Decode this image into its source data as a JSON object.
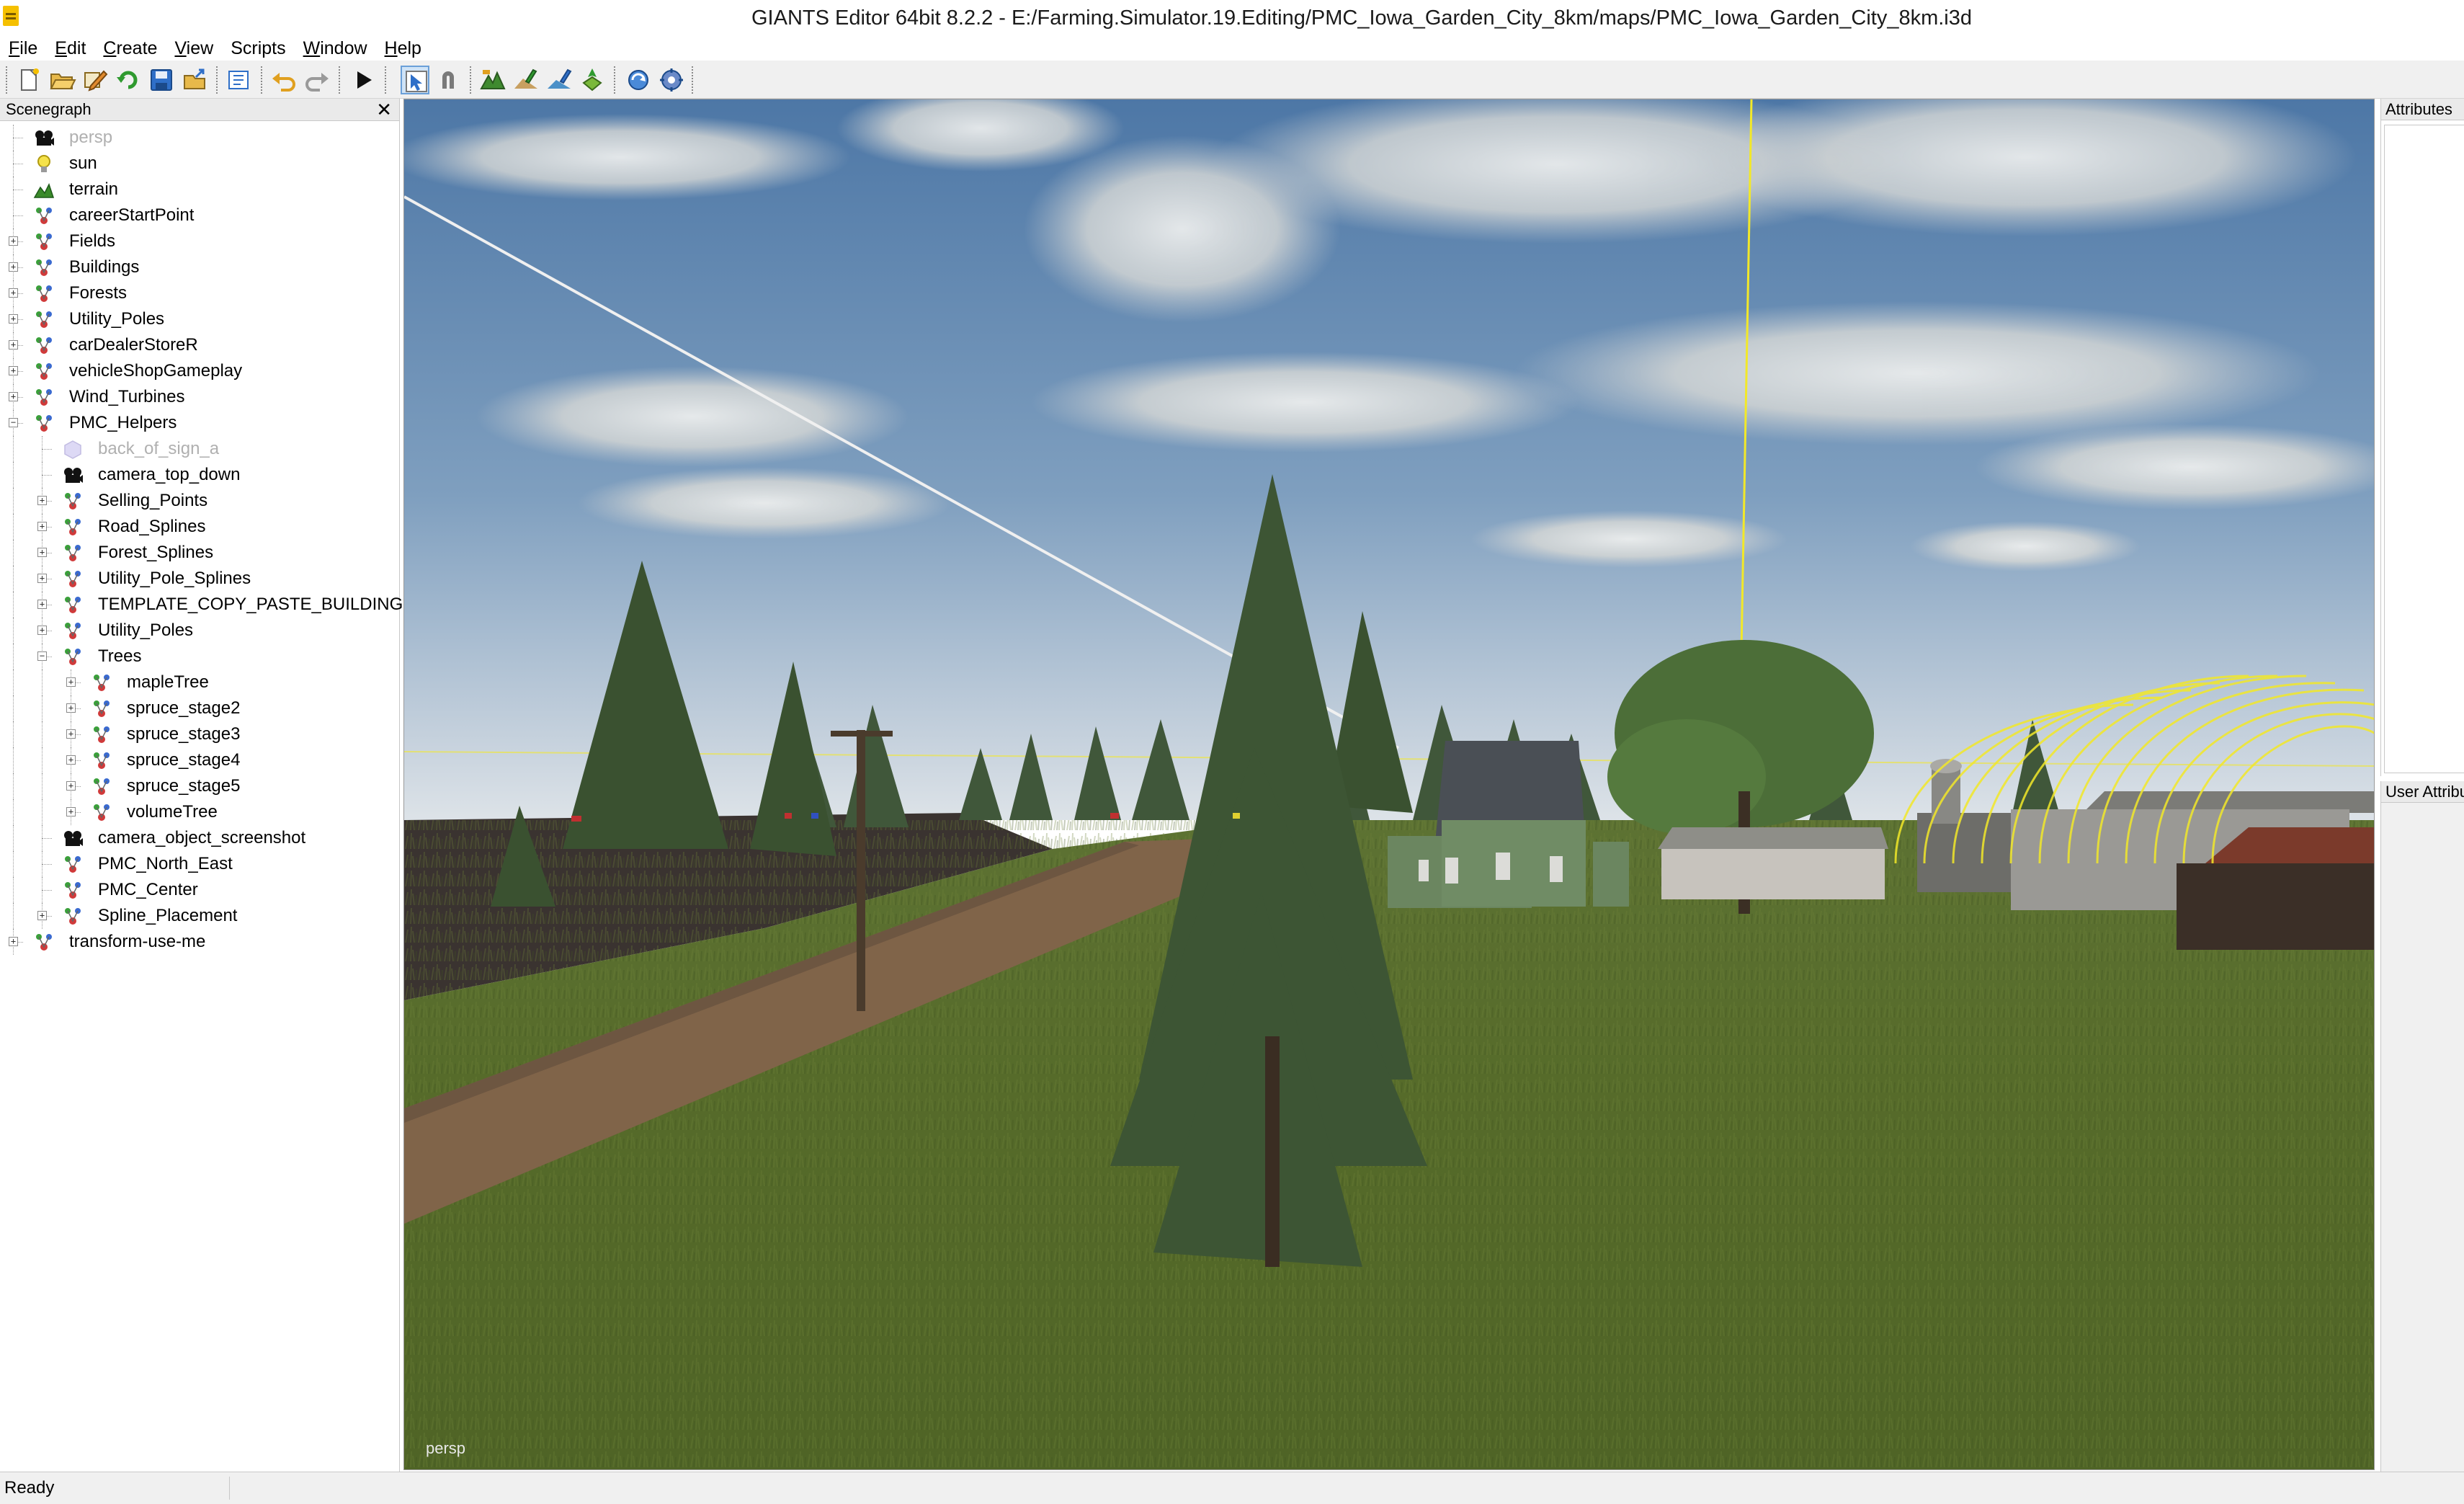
{
  "window": {
    "title": "GIANTS Editor 64bit 8.2.2 - E:/Farming.Simulator.19.Editing/PMC_Iowa_Garden_City_8km/maps/PMC_Iowa_Garden_City_8km.i3d"
  },
  "menu": [
    {
      "mnemonic": "F",
      "rest": "ile"
    },
    {
      "mnemonic": "E",
      "rest": "dit"
    },
    {
      "mnemonic": "C",
      "rest": "reate"
    },
    {
      "mnemonic": "V",
      "rest": "iew"
    },
    {
      "mnemonic": "",
      "rest": "Scripts"
    },
    {
      "mnemonic": "W",
      "rest": "indow"
    },
    {
      "mnemonic": "H",
      "rest": "elp"
    }
  ],
  "toolbar": {
    "buttons": [
      {
        "name": "new-icon"
      },
      {
        "name": "open-icon"
      },
      {
        "name": "edit-icon"
      },
      {
        "name": "reload-icon"
      },
      {
        "name": "save-icon"
      },
      {
        "name": "export-icon"
      },
      {
        "name": "import-icon"
      },
      {
        "name": "undo-icon"
      },
      {
        "name": "redo-icon"
      },
      {
        "name": "play-icon"
      },
      {
        "name": "select-tool-icon"
      },
      {
        "name": "magnet-icon"
      },
      {
        "name": "terrain-sculpt-icon"
      },
      {
        "name": "terrain-paint-icon"
      },
      {
        "name": "foliage-paint-icon"
      },
      {
        "name": "placement-icon"
      },
      {
        "name": "refresh-world-icon"
      },
      {
        "name": "settings-icon"
      }
    ]
  },
  "scenegraph": {
    "title": "Scenegraph",
    "close_label": "✕",
    "nodes": [
      {
        "label": "persp",
        "icon": "camera-icon",
        "depth": 0,
        "expander": "",
        "dim": true
      },
      {
        "label": "sun",
        "icon": "light-bulb-icon",
        "depth": 0,
        "expander": "",
        "dim": false
      },
      {
        "label": "terrain",
        "icon": "terrain-icon",
        "depth": 0,
        "expander": "",
        "dim": false
      },
      {
        "label": "careerStartPoint",
        "icon": "transform-group-icon",
        "depth": 0,
        "expander": "",
        "dim": false
      },
      {
        "label": "Fields",
        "icon": "transform-group-icon",
        "depth": 0,
        "expander": "+",
        "dim": false
      },
      {
        "label": "Buildings",
        "icon": "transform-group-icon",
        "depth": 0,
        "expander": "+",
        "dim": false
      },
      {
        "label": "Forests",
        "icon": "transform-group-icon",
        "depth": 0,
        "expander": "+",
        "dim": false
      },
      {
        "label": "Utility_Poles",
        "icon": "transform-group-icon",
        "depth": 0,
        "expander": "+",
        "dim": false
      },
      {
        "label": "carDealerStoreR",
        "icon": "transform-group-icon",
        "depth": 0,
        "expander": "+",
        "dim": false
      },
      {
        "label": "vehicleShopGameplay",
        "icon": "transform-group-icon",
        "depth": 0,
        "expander": "+",
        "dim": false
      },
      {
        "label": "Wind_Turbines",
        "icon": "transform-group-icon",
        "depth": 0,
        "expander": "+",
        "dim": false
      },
      {
        "label": "PMC_Helpers",
        "icon": "transform-group-icon",
        "depth": 0,
        "expander": "−",
        "dim": false
      },
      {
        "label": "back_of_sign_a",
        "icon": "shape-icon",
        "depth": 1,
        "expander": "",
        "dim": true
      },
      {
        "label": "camera_top_down",
        "icon": "camera-icon",
        "depth": 1,
        "expander": "",
        "dim": false
      },
      {
        "label": "Selling_Points",
        "icon": "transform-group-icon",
        "depth": 1,
        "expander": "+",
        "dim": false
      },
      {
        "label": "Road_Splines",
        "icon": "transform-group-icon",
        "depth": 1,
        "expander": "+",
        "dim": false
      },
      {
        "label": "Forest_Splines",
        "icon": "transform-group-icon",
        "depth": 1,
        "expander": "+",
        "dim": false
      },
      {
        "label": "Utility_Pole_Splines",
        "icon": "transform-group-icon",
        "depth": 1,
        "expander": "+",
        "dim": false
      },
      {
        "label": "TEMPLATE_COPY_PASTE_BUILDING",
        "icon": "transform-group-icon",
        "depth": 1,
        "expander": "+",
        "dim": false
      },
      {
        "label": "Utility_Poles",
        "icon": "transform-group-icon",
        "depth": 1,
        "expander": "+",
        "dim": false
      },
      {
        "label": "Trees",
        "icon": "transform-group-icon",
        "depth": 1,
        "expander": "−",
        "dim": false
      },
      {
        "label": "mapleTree",
        "icon": "transform-group-icon",
        "depth": 2,
        "expander": "+",
        "dim": false
      },
      {
        "label": "spruce_stage2",
        "icon": "transform-group-icon",
        "depth": 2,
        "expander": "+",
        "dim": false
      },
      {
        "label": "spruce_stage3",
        "icon": "transform-group-icon",
        "depth": 2,
        "expander": "+",
        "dim": false
      },
      {
        "label": "spruce_stage4",
        "icon": "transform-group-icon",
        "depth": 2,
        "expander": "+",
        "dim": false
      },
      {
        "label": "spruce_stage5",
        "icon": "transform-group-icon",
        "depth": 2,
        "expander": "+",
        "dim": false
      },
      {
        "label": "volumeTree",
        "icon": "transform-group-icon",
        "depth": 2,
        "expander": "+",
        "dim": false
      },
      {
        "label": "camera_object_screenshot",
        "icon": "camera-icon",
        "depth": 1,
        "expander": "",
        "dim": false
      },
      {
        "label": "PMC_North_East",
        "icon": "transform-group-icon",
        "depth": 1,
        "expander": "",
        "dim": false
      },
      {
        "label": "PMC_Center",
        "icon": "transform-group-icon",
        "depth": 1,
        "expander": "",
        "dim": false
      },
      {
        "label": "Spline_Placement",
        "icon": "transform-group-icon",
        "depth": 1,
        "expander": "+",
        "dim": false
      },
      {
        "label": "transform-use-me",
        "icon": "transform-group-icon",
        "depth": 0,
        "expander": "+",
        "dim": false
      }
    ]
  },
  "viewport": {
    "camera_label": "persp"
  },
  "attributes": {
    "title": "Attributes"
  },
  "user_attributes": {
    "title": "User Attributes"
  },
  "status": {
    "text": "Ready"
  },
  "colors": {
    "sky_top": "#4f7aa8",
    "sky_horizon": "#c9d6e3",
    "grass": "#5a6e2a",
    "helper_yellow": "#f2e829",
    "tree_green": "#3c5632"
  }
}
